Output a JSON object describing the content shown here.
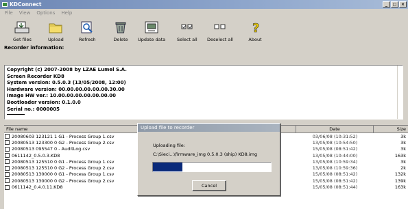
{
  "window": {
    "title": "KDConnect",
    "minimize": "_",
    "maximize": "□",
    "close": "×"
  },
  "menu": [
    "File",
    "View",
    "Options",
    "Help"
  ],
  "toolbar": {
    "get_files": "Get files",
    "upload": "Upload",
    "refresh": "Refresh",
    "delete": "Delete",
    "update_data": "Update data",
    "select_all": "Select all",
    "deselect_all": "Deselect all",
    "about": "About"
  },
  "recorder_info_label": "Recorder information:",
  "info": {
    "copyright": "Copyright (c) 2007-2008 by LZAE Lumel S.A.",
    "screen": "Screen Recorder KD8",
    "system": "System version: 0.5.0.3 (13/05/2008, 12:00)",
    "hardware": "Hardware version: 00.00.00.00.00.00.30.00",
    "image_hw": "Image HW ver.: 10.00.00.00.00.00.00.00",
    "bootloader": "Bootloader version: 0.1.0.0",
    "serial": "Serial no.: 0000005"
  },
  "table": {
    "headers": {
      "name": "File name",
      "date": "Date",
      "size": "Size"
    },
    "rows": [
      {
        "name": "20080603 123121 1 G1 - Process Group 1.csv",
        "date": "03/06/08 (10:31:52)",
        "size": "3k"
      },
      {
        "name": "20080513 123300 0 G2 - Process Group 2.csv",
        "date": "13/05/08 (10:54:50)",
        "size": "3k"
      },
      {
        "name": "20080513 095547 0 - AuditLog.csv",
        "date": "15/05/08 (08:51:42)",
        "size": "3k"
      },
      {
        "name": "0611142_0.5.0.3.KD8",
        "date": "13/05/08 (10:44:00)",
        "size": "163k"
      },
      {
        "name": "20080513 125510 0 G1 - Process Group 1.csv",
        "date": "13/05/08 (10:59:34)",
        "size": "3k"
      },
      {
        "name": "20080513 125510 0 G2 - Process Group 2.csv",
        "date": "13/05/08 (10:59:36)",
        "size": "2k"
      },
      {
        "name": "20080513 130000 0 G1 - Process Group 1.csv",
        "date": "15/05/08 (08:51:42)",
        "size": "132k"
      },
      {
        "name": "20080513 130000 0 G2 - Process Group 2.csv",
        "date": "15/05/08 (08:51:42)",
        "size": "139k"
      },
      {
        "name": "0611142_0.4.0.11.KD8",
        "date": "15/05/08 (08:51:44)",
        "size": "163k"
      }
    ]
  },
  "dialog": {
    "title": "Upload file to recorder",
    "uploading_label": "Uploading file:",
    "path": "C:\\Sieci...\\firmware_img 0.5.0.3 (ship)  KD8.img",
    "progress": 0.25,
    "cancel": "Cancel"
  }
}
